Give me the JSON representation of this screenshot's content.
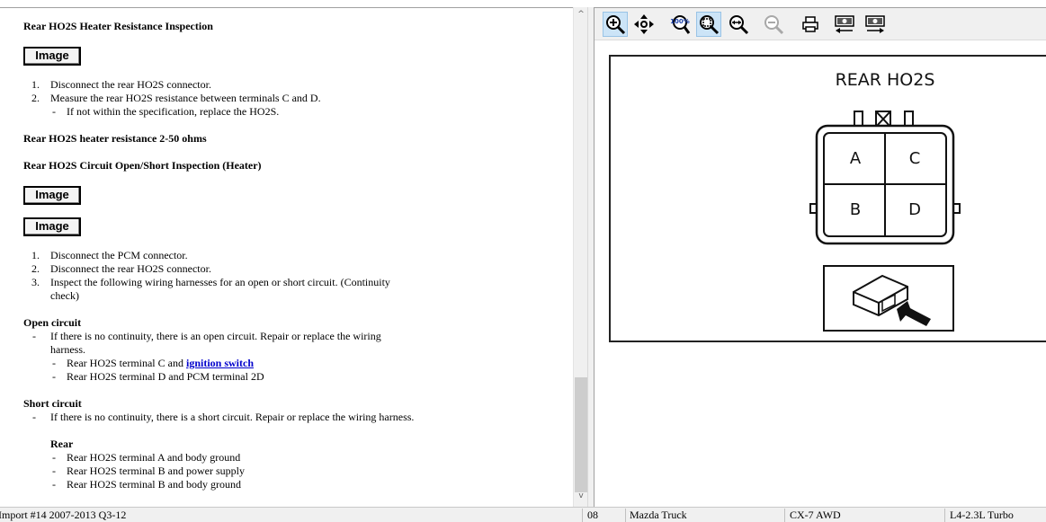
{
  "document": {
    "heading1": "Rear HO2S Heater Resistance Inspection",
    "image_button_label": "Image",
    "steps1": [
      {
        "num": "1.",
        "text": "Disconnect the rear HO2S connector."
      },
      {
        "num": "2.",
        "text": "Measure the rear HO2S resistance between terminals C and D."
      }
    ],
    "steps1_sub": "If not within the specification, replace the HO2S.",
    "spec": "Rear HO2S heater resistance 2-50 ohms",
    "heading2": "Rear HO2S Circuit Open/Short Inspection (Heater)",
    "steps2": [
      {
        "num": "1.",
        "text": "Disconnect the PCM connector."
      },
      {
        "num": "2.",
        "text": "Disconnect the rear HO2S connector."
      },
      {
        "num": "3.",
        "text": "Inspect the following wiring harnesses for an open or short circuit. (Continuity"
      }
    ],
    "steps2_cont": "check)",
    "open_circuit": {
      "heading": "Open circuit",
      "line1": "If there is no continuity, there is an open circuit. Repair or replace the wiring",
      "line1_cont": "harness.",
      "item1_prefix": "Rear HO2S terminal C and ",
      "item1_link": "ignition switch",
      "item2": "Rear HO2S terminal D and PCM terminal 2D"
    },
    "short_circuit": {
      "heading": "Short circuit",
      "line1": "If there is no continuity, there is a short circuit. Repair or replace the wiring harness.",
      "sub_heading": "Rear",
      "items": [
        "Rear HO2S terminal A and body ground",
        "Rear HO2S terminal B and power supply",
        "Rear HO2S terminal B and body ground"
      ]
    },
    "dash": "-"
  },
  "diagram": {
    "title": "REAR HO2S",
    "terminals": [
      "A",
      "C",
      "B",
      "D"
    ]
  },
  "toolbar": {
    "zoom_100_label": "100%"
  },
  "statusbar": {
    "import": "Import #14 2007-2013 Q3-12",
    "code": "08",
    "make": "Mazda Truck",
    "model": "CX-7 AWD",
    "engine": "L4-2.3L Turbo"
  },
  "scroll": {
    "up_glyph": "^",
    "down_glyph": "v"
  },
  "colors": {
    "link": "#0000cc",
    "toolbar_bg": "#f0f0f0",
    "active_btn": "#cce4f7"
  }
}
